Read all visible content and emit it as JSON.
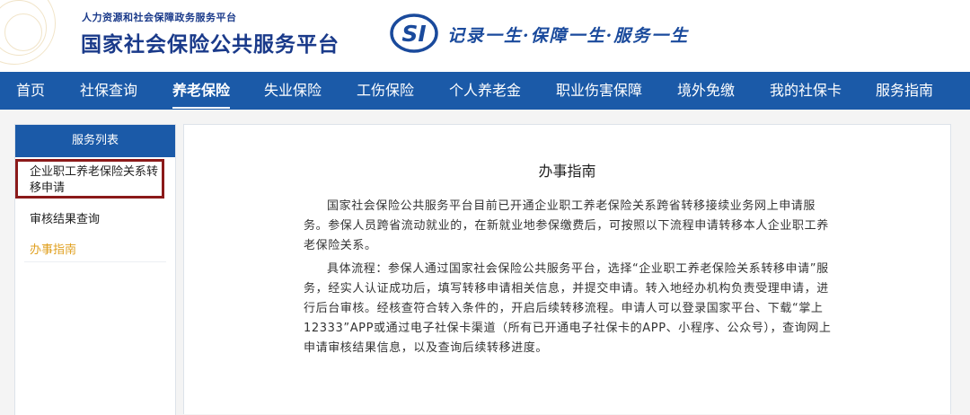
{
  "header": {
    "sub_title": "人力资源和社会保障政务服务平台",
    "main_title": "国家社会保险公共服务平台",
    "logo_icon": "si-logo-icon",
    "slogan": "记录一生·保障一生·服务一生",
    "brand_color": "#1b5aa8"
  },
  "nav": {
    "items": [
      {
        "label": "首页"
      },
      {
        "label": "社保查询"
      },
      {
        "label": "养老保险"
      },
      {
        "label": "失业保险"
      },
      {
        "label": "工伤保险"
      },
      {
        "label": "个人养老金"
      },
      {
        "label": "职业伤害保障"
      },
      {
        "label": "境外免缴"
      },
      {
        "label": "我的社保卡"
      },
      {
        "label": "服务指南"
      }
    ],
    "active": "养老保险"
  },
  "sidebar": {
    "title": "服务列表",
    "items": [
      {
        "label": "企业职工养老保险关系转移申请"
      },
      {
        "label": "审核结果查询"
      },
      {
        "label": "办事指南"
      }
    ],
    "highlight_color": "#8b1a1a",
    "current_color": "#e0a020"
  },
  "content": {
    "title": "办事指南",
    "paragraphs": [
      "国家社会保险公共服务平台目前已开通企业职工养老保险关系跨省转移接续业务网上申请服务。参保人员跨省流动就业的，在新就业地参保缴费后，可按照以下流程申请转移本人企业职工养老保险关系。",
      "具体流程：参保人通过国家社会保险公共服务平台，选择“企业职工养老保险关系转移申请”服务，经实人认证成功后，填写转移申请相关信息，并提交申请。转入地经办机构负责受理申请，进行后台审核。经核查符合转入条件的，开启后续转移流程。申请人可以登录国家平台、下载“掌上12333”APP或通过电子社保卡渠道（所有已开通电子社保卡的APP、小程序、公众号），查询网上申请审核结果信息，以及查询后续转移进度。"
    ]
  }
}
